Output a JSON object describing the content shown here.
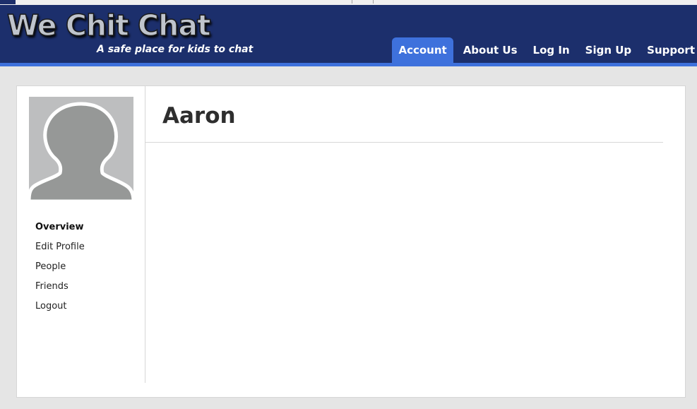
{
  "site": {
    "logo_text": "We Chit Chat",
    "tagline": "A safe place for kids to chat"
  },
  "nav": {
    "items": [
      {
        "label": "Account",
        "active": true
      },
      {
        "label": "About Us",
        "active": false
      },
      {
        "label": "Log In",
        "active": false
      },
      {
        "label": "Sign Up",
        "active": false
      },
      {
        "label": "Support",
        "active": false
      }
    ]
  },
  "profile": {
    "name": "Aaron",
    "avatar_icon": "default-user-silhouette-icon"
  },
  "sidebar": {
    "items": [
      {
        "label": "Overview",
        "current": true
      },
      {
        "label": "Edit Profile",
        "current": false
      },
      {
        "label": "People",
        "current": false
      },
      {
        "label": "Friends",
        "current": false
      },
      {
        "label": "Logout",
        "current": false
      }
    ]
  },
  "colors": {
    "header_bg": "#1c2f6c",
    "accent": "#3e71dc",
    "page_bg": "#e5e5e5"
  }
}
